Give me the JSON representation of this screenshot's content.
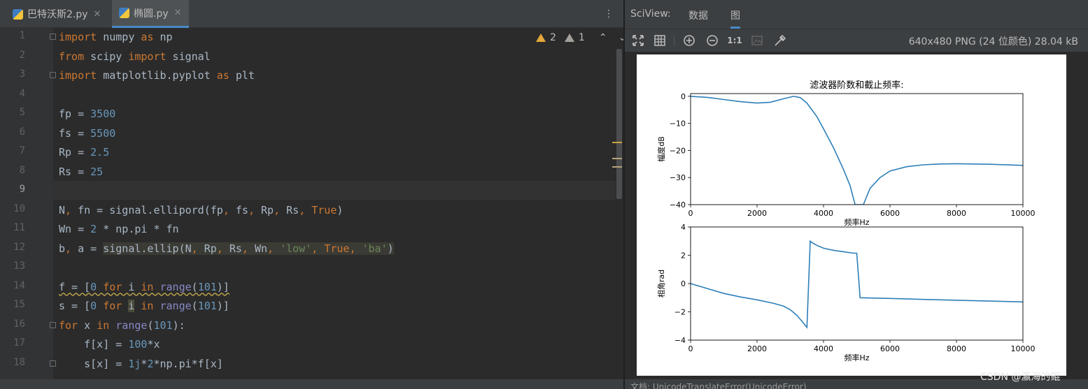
{
  "editor": {
    "tabs": [
      {
        "label": "巴特沃斯2.py",
        "active": false
      },
      {
        "label": "椭圆.py",
        "active": true
      }
    ],
    "menu_icon": "vertical-dots-icon",
    "inspections": {
      "warnings": "2",
      "weak_warnings": "1"
    },
    "current_line": 9,
    "line_numbers": [
      "1",
      "2",
      "3",
      "4",
      "5",
      "6",
      "7",
      "8",
      "9",
      "10",
      "11",
      "12",
      "13",
      "14",
      "15",
      "16",
      "17",
      "18"
    ],
    "code": [
      "import numpy as np",
      "from scipy import signal",
      "import matplotlib.pyplot as plt",
      "",
      "fp = 3500",
      "fs = 5500",
      "Rp = 2.5",
      "Rs = 25",
      "",
      "N, fn = signal.ellipord(fp, fs, Rp, Rs, True)",
      "Wn = 2 * np.pi * fn",
      "b, a = signal.ellip(N, Rp, Rs, Wn, 'low', True, 'ba')",
      "",
      "f = [0 for i in range(101)]",
      "s = [0 for i in range(101)]",
      "for x in range(101):",
      "    f[x] = 100*x",
      "    s[x] = 1j*2*np.pi*f[x]"
    ]
  },
  "sciview": {
    "title": "SciView:",
    "tabs": [
      {
        "label": "数据",
        "active": false
      },
      {
        "label": "图",
        "active": true
      }
    ],
    "toolbar": {
      "zoom_label": "1:1",
      "icons": [
        "fit-screen-icon",
        "grid-icon",
        "zoom-in-icon",
        "zoom-out-icon",
        "actual-size-icon",
        "background-icon",
        "color-picker-icon"
      ]
    },
    "image_info": "640x480 PNG (24 位颜色) 28.04 kB",
    "bottom_message": "文档:   UnicodeTranslateError(UnicodeError)",
    "watermark": "CSDN @瀛海的鲲"
  },
  "colors": {
    "line": "#2e7fb8",
    "keyword": "#cc7832",
    "number": "#6897bb",
    "string": "#6a8759",
    "builtin": "#8888c6"
  },
  "chart_data": [
    {
      "type": "line",
      "title": "滤波器阶数和截止频率:",
      "xlabel": "频率Hz",
      "ylabel": "幅度dB",
      "xlim": [
        0,
        10000
      ],
      "ylim": [
        -40,
        1
      ],
      "xticks": [
        "0",
        "2000",
        "4000",
        "6000",
        "8000",
        "10000"
      ],
      "yticks": [
        "0",
        "−10",
        "−20",
        "−30",
        "−40"
      ],
      "x": [
        0,
        500,
        1000,
        1500,
        2000,
        2400,
        2800,
        3100,
        3300,
        3500,
        3800,
        4000,
        4300,
        4600,
        4800,
        4950,
        5200,
        5400,
        5700,
        6000,
        6500,
        7000,
        7500,
        8000,
        9000,
        10000
      ],
      "y": [
        0,
        -0.4,
        -1.2,
        -2.0,
        -2.5,
        -2.2,
        -0.9,
        0,
        -0.5,
        -2.5,
        -7.5,
        -12,
        -19,
        -27,
        -33,
        -40,
        -40,
        -34,
        -30,
        -27.6,
        -26,
        -25.3,
        -25,
        -24.9,
        -25.1,
        -25.5
      ]
    },
    {
      "type": "line",
      "title": "",
      "xlabel": "频率Hz",
      "ylabel": "相角rad",
      "xlim": [
        0,
        10000
      ],
      "ylim": [
        -4,
        4
      ],
      "xticks": [
        "0",
        "2000",
        "4000",
        "6000",
        "8000",
        "10000"
      ],
      "yticks": [
        "4",
        "2",
        "0",
        "−2",
        "−4"
      ],
      "x": [
        0,
        500,
        1000,
        1500,
        2000,
        2500,
        2800,
        3000,
        3200,
        3400,
        3500,
        3600,
        3650,
        3800,
        4000,
        4300,
        4600,
        4900,
        5000,
        5100,
        6000,
        7000,
        8000,
        9000,
        10000
      ],
      "y": [
        0,
        -0.35,
        -0.7,
        -0.95,
        -1.15,
        -1.4,
        -1.6,
        -1.85,
        -2.25,
        -2.8,
        -3.1,
        3.0,
        2.9,
        2.7,
        2.5,
        2.35,
        2.25,
        2.15,
        2.15,
        -1.0,
        -1.05,
        -1.12,
        -1.18,
        -1.24,
        -1.3
      ]
    }
  ]
}
